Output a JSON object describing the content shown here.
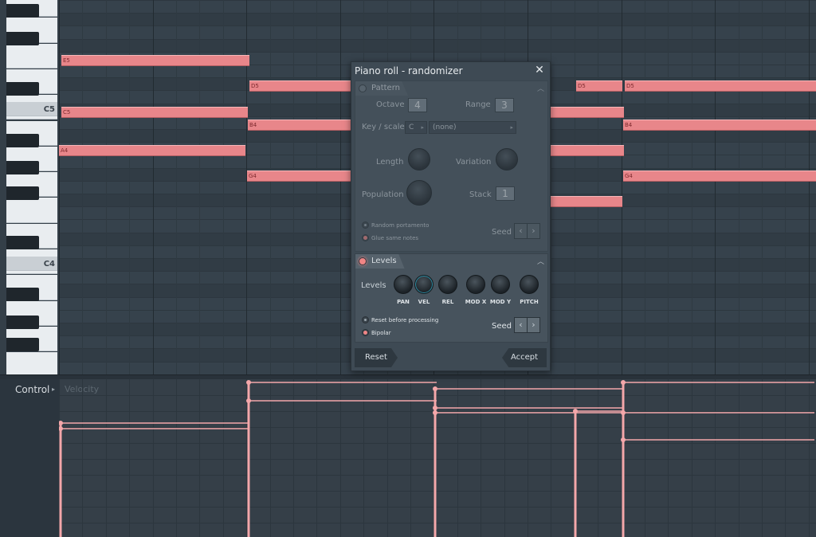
{
  "keyboard": {
    "label_c5": "C5",
    "label_c4": "C4"
  },
  "notes": [
    {
      "id": "n-e5",
      "label": "E5"
    },
    {
      "id": "n-c5",
      "label": "C5"
    },
    {
      "id": "n-a4",
      "label": "A4"
    },
    {
      "id": "n-d5a",
      "label": "D5"
    },
    {
      "id": "n-b4a",
      "label": "B4"
    },
    {
      "id": "n-g4a",
      "label": "G4"
    },
    {
      "id": "n-d5b",
      "label": "D5"
    },
    {
      "id": "n-d5c",
      "label": "D5"
    },
    {
      "id": "n-b4b",
      "label": "B4"
    },
    {
      "id": "n-g4b",
      "label": "G4"
    }
  ],
  "control": {
    "label": "Control",
    "arrow": "▸",
    "parameter": "Velocity"
  },
  "dialog": {
    "title": "Piano roll - randomizer",
    "close": "✕",
    "pattern": {
      "tab": "Pattern",
      "collapse": "︿",
      "octave_label": "Octave",
      "octave_value": "4",
      "range_label": "Range",
      "range_value": "3",
      "key_scale_label": "Key / scale",
      "key_value": "C",
      "scale_value": "(none)",
      "length_label": "Length",
      "variation_label": "Variation",
      "population_label": "Population",
      "stack_label": "Stack",
      "stack_value": "1",
      "random_portamento": "Random portamento",
      "glue_same_notes": "Glue same notes",
      "seed_label": "Seed"
    },
    "levels": {
      "tab": "Levels",
      "collapse": "︿",
      "row_label": "Levels",
      "knobs": [
        "PAN",
        "VEL",
        "REL",
        "MOD X",
        "MOD Y",
        "PITCH"
      ],
      "reset_before_processing": "Reset before processing",
      "bipolar": "Bipolar",
      "seed_label": "Seed"
    },
    "reset_button": "Reset",
    "accept_button": "Accept"
  },
  "colors": {
    "note": "#e8868a",
    "accent": "#f08585",
    "grid": "#36424c"
  }
}
